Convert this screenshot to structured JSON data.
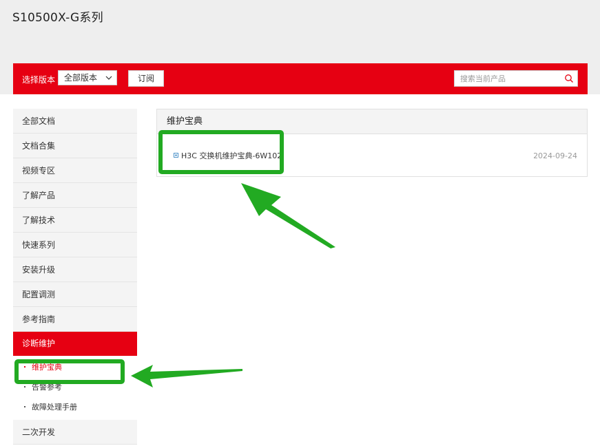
{
  "header": {
    "title": "S10500X-G系列"
  },
  "toolbar": {
    "version_label": "选择版本",
    "version_selected": "全部版本",
    "subscribe_label": "订阅",
    "search_placeholder": "搜索当前产品"
  },
  "sidebar": {
    "items": [
      {
        "label": "全部文档"
      },
      {
        "label": "文档合集"
      },
      {
        "label": "视频专区"
      },
      {
        "label": "了解产品"
      },
      {
        "label": "了解技术"
      },
      {
        "label": "快速系列"
      },
      {
        "label": "安装升级"
      },
      {
        "label": "配置调测"
      },
      {
        "label": "参考指南"
      },
      {
        "label": "诊断维护"
      },
      {
        "label": "二次开发"
      }
    ],
    "active_sub": [
      {
        "label": "维护宝典"
      },
      {
        "label": "告警参考"
      },
      {
        "label": "故障处理手册"
      }
    ]
  },
  "panel": {
    "title": "维护宝典",
    "rows": [
      {
        "title": "H3C 交换机维护宝典-6W102",
        "date": "2024-09-24"
      }
    ]
  },
  "colors": {
    "brand_red": "#e60012",
    "annotation_green": "#22aa22",
    "band_gray": "#eeeeee"
  }
}
